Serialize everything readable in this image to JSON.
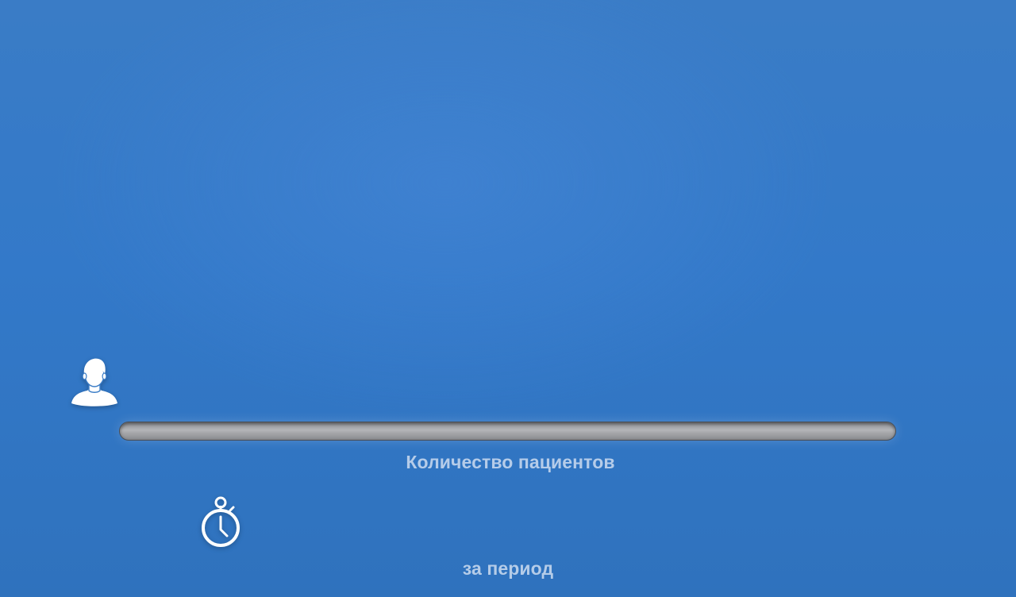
{
  "patients": {
    "label": "Количество пациентов",
    "icon": "patient-avatar-icon",
    "progress": 0
  },
  "period": {
    "label": "за период",
    "icon": "stopwatch-icon"
  },
  "colors": {
    "background": "#3379c9",
    "caption": "#cddcf0",
    "track": "#a6a7aa"
  }
}
